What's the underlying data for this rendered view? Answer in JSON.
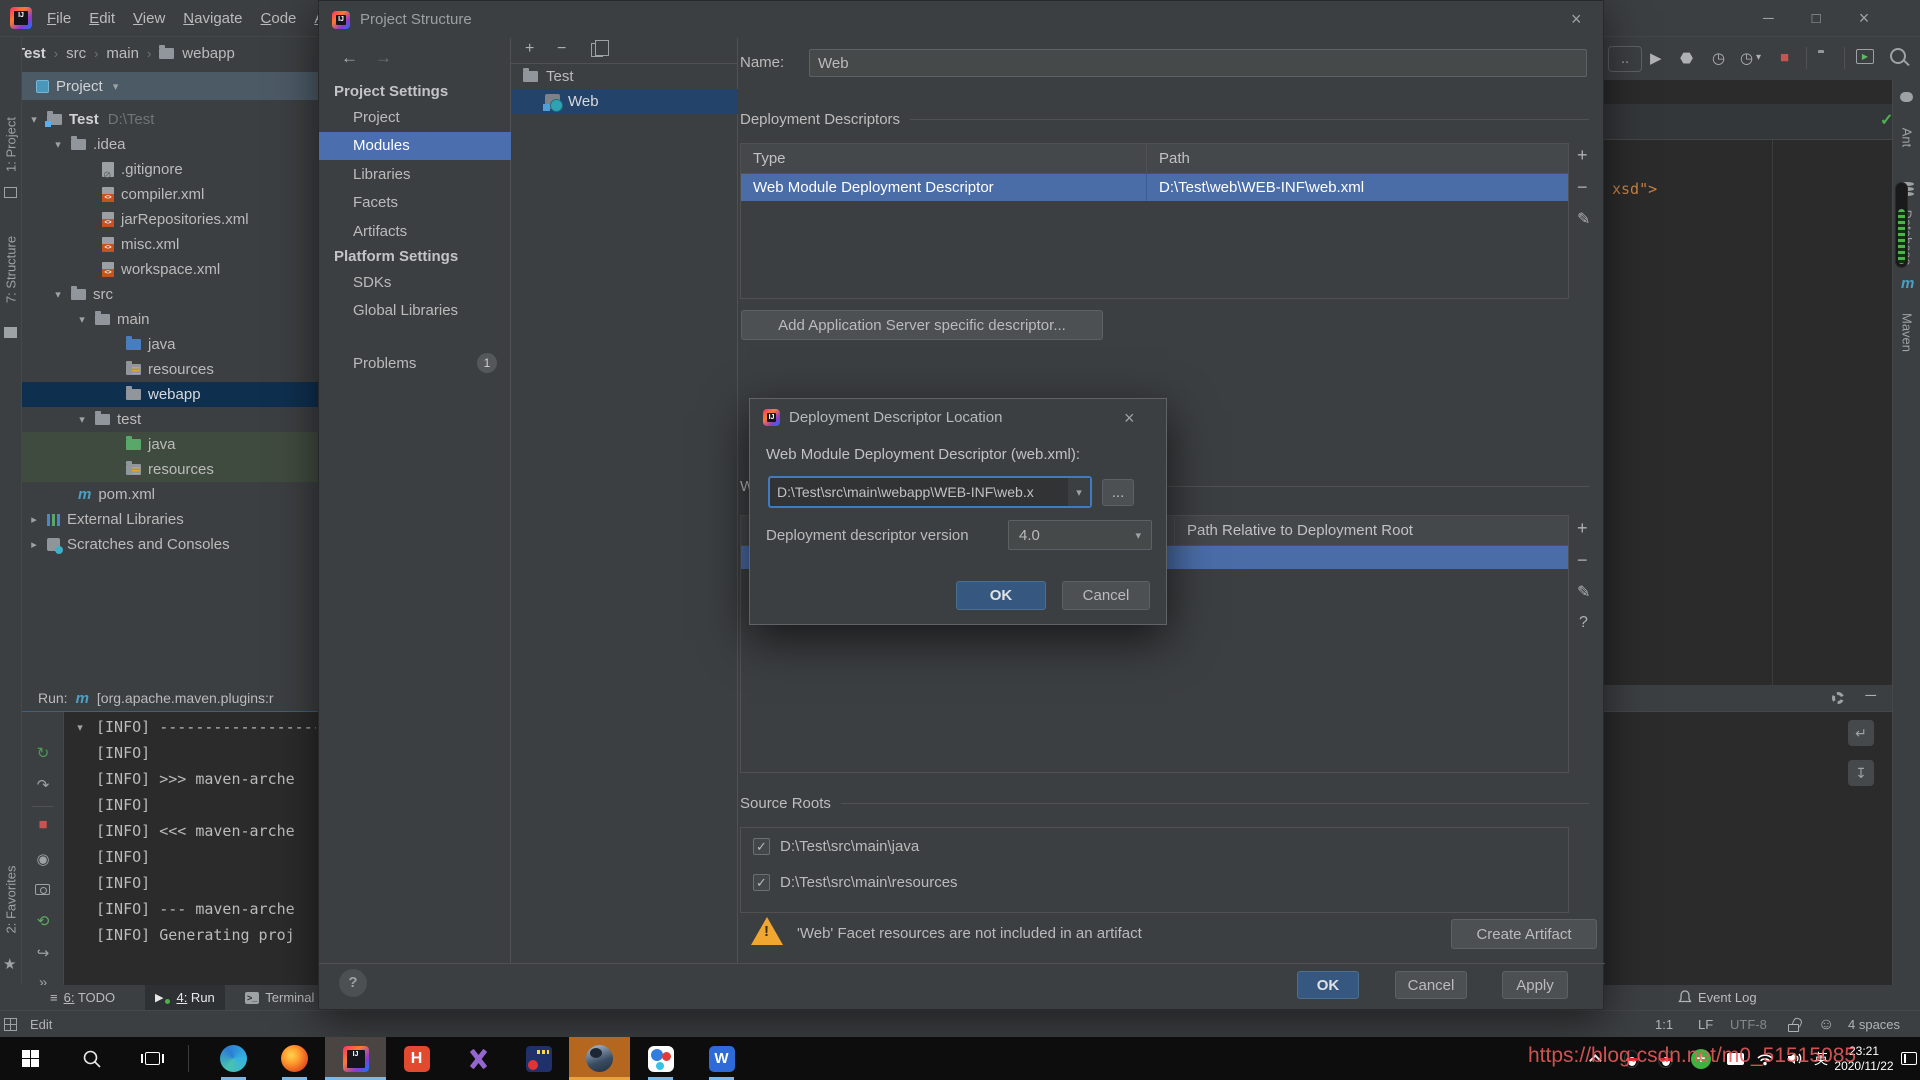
{
  "icons": {
    "back": "←",
    "forward": "→",
    "add": "+",
    "remove": "−",
    "edit": "✎",
    "help": "?",
    "close": "×",
    "minimize": "─",
    "maximize": "□",
    "combo_arrow": "▾",
    "chevron_down": "▾",
    "chevron_right": "▸",
    "crumb_sep": "›",
    "rerun": "↻",
    "rerun_failed": "↷",
    "stop": "■",
    "eye": "◉",
    "restore": "⟲",
    "exit": "↪",
    "more": "»",
    "check": "✓",
    "hamburger": "≡",
    "play": "▶",
    "bug": "⬣",
    "profiler": "◷",
    "softwrap": "↵",
    "scrollend": "↧",
    "question": "?",
    "dots": "..",
    "maven_m": "m",
    "terminal": ">_"
  },
  "menu": {
    "items": [
      "File",
      "Edit",
      "View",
      "Navigate",
      "Code",
      "A"
    ]
  },
  "window_title": "Project Structure",
  "breadcrumb": {
    "items": [
      "Test",
      "src",
      "main",
      "webapp"
    ]
  },
  "left_stripe": {
    "project": "1: Project",
    "structure": "7: Structure",
    "favorites": "2: Favorites"
  },
  "right_stripe": {
    "items": [
      "Ant",
      "Database",
      "Maven"
    ]
  },
  "project_panel": {
    "header": "Project",
    "tree": [
      {
        "label": "Test",
        "hint": "D:\\Test"
      },
      {
        "label": ".idea"
      },
      {
        "label": ".gitignore"
      },
      {
        "label": "compiler.xml"
      },
      {
        "label": "jarRepositories.xml"
      },
      {
        "label": "misc.xml"
      },
      {
        "label": "workspace.xml"
      },
      {
        "label": "src"
      },
      {
        "label": "main"
      },
      {
        "label": "java"
      },
      {
        "label": "resources"
      },
      {
        "label": "webapp"
      },
      {
        "label": "test"
      },
      {
        "label": "java"
      },
      {
        "label": "resources"
      },
      {
        "label": "pom.xml"
      },
      {
        "label": "External Libraries"
      },
      {
        "label": "Scratches and Consoles"
      }
    ]
  },
  "run_panel": {
    "label": "Run:",
    "config": "[org.apache.maven.plugins:r",
    "lines": [
      "[INFO] ------------------------",
      "[INFO]",
      "[INFO] >>> maven-arche",
      "[INFO]",
      "[INFO] <<< maven-arche",
      "[INFO]",
      "[INFO]",
      "[INFO] --- maven-arche",
      "[INFO] Generating proj"
    ]
  },
  "bottom_tabs": {
    "todo": "6: TODO",
    "run": "4: Run",
    "terminal": "Terminal",
    "event_log": "Event Log"
  },
  "status_bar": {
    "mode": "Edit",
    "caret": "1:1",
    "line_sep": "LF",
    "encoding": "UTF-8",
    "indent": "4 spaces"
  },
  "editor": {
    "code": "xsd\">"
  },
  "dialog": {
    "title": "Project Structure",
    "sidebar": {
      "group1": "Project Settings",
      "items1": [
        "Project",
        "Modules",
        "Libraries",
        "Facets",
        "Artifacts"
      ],
      "group2": "Platform Settings",
      "items2": [
        "SDKs",
        "Global Libraries"
      ],
      "problems": "Problems",
      "problems_count": "1"
    },
    "module_tree": {
      "root": "Test",
      "module": "Web"
    },
    "content": {
      "name_label": "Name:",
      "name_value": "Web",
      "dd_section": "Deployment Descriptors",
      "table": {
        "col_type": "Type",
        "col_path": "Path",
        "row_type": "Web Module Deployment Descriptor",
        "row_path": "D:\\Test\\web\\WEB-INF\\web.xml"
      },
      "add_button": "Add Application Server specific descriptor...",
      "wrd_section": "Web Resource Directories",
      "wrd_col_path": "Path Relative to Deployment Root",
      "sr_section": "Source Roots",
      "roots": [
        "D:\\Test\\src\\main\\java",
        "D:\\Test\\src\\main\\resources"
      ],
      "warning": "'Web' Facet resources are not included in an artifact",
      "create_artifact": "Create Artifact"
    },
    "buttons": {
      "ok": "OK",
      "cancel": "Cancel",
      "apply": "Apply"
    }
  },
  "popup": {
    "title": "Deployment Descriptor Location",
    "label": "Web Module Deployment Descriptor (web.xml):",
    "path_value": "D:\\Test\\src\\main\\webapp\\WEB-INF\\web.x",
    "browse": "...",
    "version_label": "Deployment descriptor version",
    "version_value": "4.0",
    "ok": "OK",
    "cancel": "Cancel"
  },
  "taskbar": {
    "time": "23:21",
    "date": "2020/11/22",
    "ime": "英"
  },
  "watermark": "https://blog.csdn.net/m0_51515085",
  "colors": {
    "accent_blue": "#4b6eaf",
    "table_selection": "#4a6da8",
    "primary_button": "#365880",
    "warning": "#f0a732",
    "stop_red": "#c75450",
    "run_green": "#499c54"
  }
}
